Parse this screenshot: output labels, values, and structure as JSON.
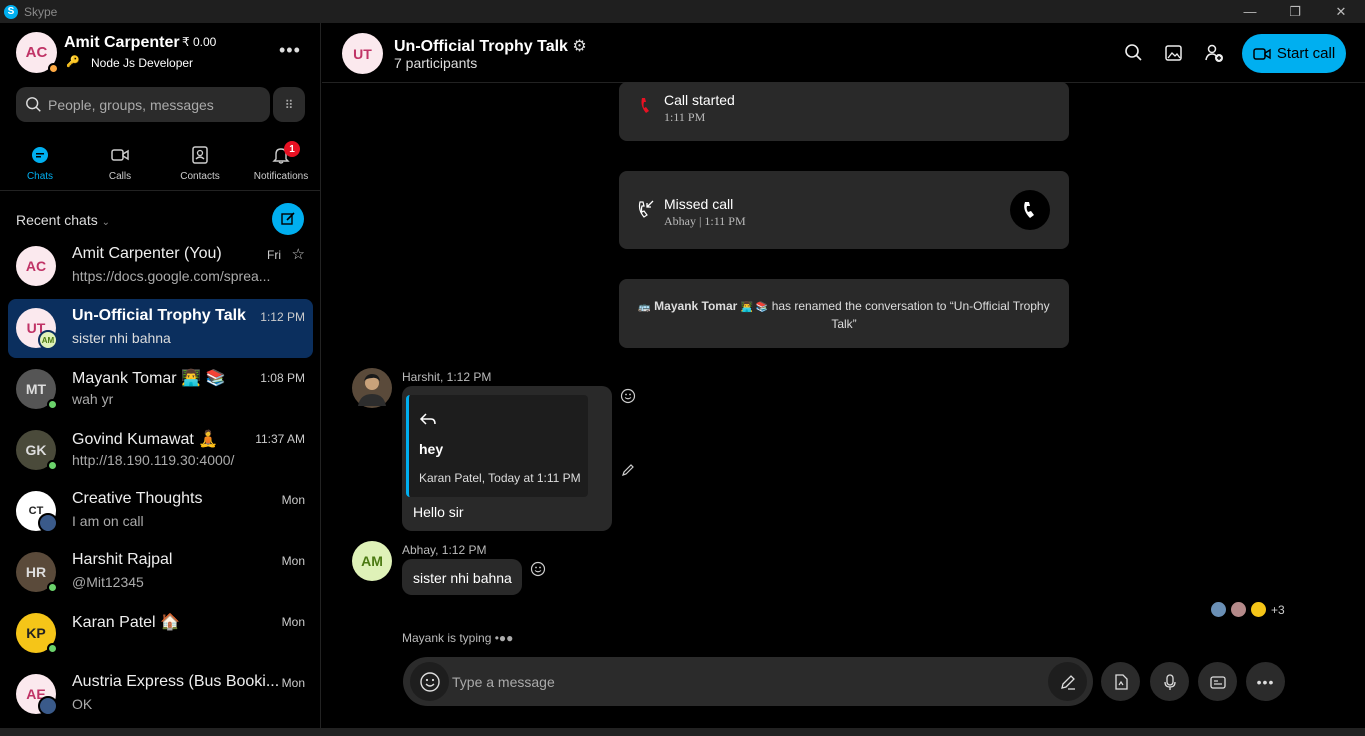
{
  "window": {
    "title": "Skype"
  },
  "profile": {
    "initials": "AC",
    "name": "Amit Carpenter",
    "credit": "₹ 0.00",
    "mood": "Node Js Developer",
    "status_color": "#ffaa44"
  },
  "search": {
    "placeholder": "People, groups, messages"
  },
  "nav": {
    "tabs": [
      {
        "label": "Chats",
        "icon": "chat-icon"
      },
      {
        "label": "Calls",
        "icon": "video-icon"
      },
      {
        "label": "Contacts",
        "icon": "contacts-icon"
      },
      {
        "label": "Notifications",
        "icon": "bell-icon",
        "badge": "1"
      }
    ]
  },
  "recent": {
    "header": "Recent chats",
    "chats": [
      {
        "initials": "AC",
        "name": "Amit Carpenter (You)",
        "preview": "https://docs.google.com/sprea...",
        "time": "Fri"
      },
      {
        "initials": "UT",
        "badge_initials": "AM",
        "name": "Un-Official Trophy Talk",
        "preview": "sister nhi bahna",
        "time": "1:12 PM"
      },
      {
        "initials": "MT",
        "name": "Mayank Tomar 👨‍💻 📚",
        "preview": "wah yr",
        "time": "1:08 PM"
      },
      {
        "initials": "GK",
        "name": "Govind Kumawat 🧘",
        "preview": "http://18.190.119.30:4000/",
        "time": "11:37 AM"
      },
      {
        "initials": "CT",
        "name": "Creative Thoughts",
        "preview": "I am on call",
        "time": "Mon"
      },
      {
        "initials": "HR",
        "name": "Harshit Rajpal",
        "preview": "@Mit12345",
        "time": "Mon"
      },
      {
        "initials": "KP",
        "name": "Karan Patel 🏠",
        "preview": "",
        "time": "Mon"
      },
      {
        "initials": "AE",
        "name": "Austria Express (Bus Booki...",
        "preview": "OK",
        "time": "Mon"
      }
    ]
  },
  "conversation": {
    "initials": "UT",
    "title": "Un-Official Trophy Talk",
    "participants": "7 participants",
    "start_call": "Start call"
  },
  "events": {
    "call_started": {
      "title": "Call started",
      "time": "1:11 PM"
    },
    "missed_call": {
      "title": "Missed call",
      "sub": "Abhay | 1:11 PM"
    },
    "rename": {
      "actor": "Mayank Tomar",
      "text": "has renamed the conversation to “Un-Official Trophy Talk”"
    }
  },
  "messages": [
    {
      "sender": "Harshit, 1:12 PM",
      "quote_text": "hey",
      "quote_meta": "Karan Patel, Today at 1:11 PM",
      "text": "Hello sir"
    },
    {
      "initials": "AM",
      "sender": "Abhay, 1:12 PM",
      "text": "sister nhi bahna"
    }
  ],
  "read_receipts": {
    "more": "+3"
  },
  "typing": "Mayank is typing",
  "composer": {
    "placeholder": "Type a message"
  },
  "colors": {
    "accent": "#00aff0",
    "online": "#6bd26b",
    "missed_red": "#e81123"
  }
}
